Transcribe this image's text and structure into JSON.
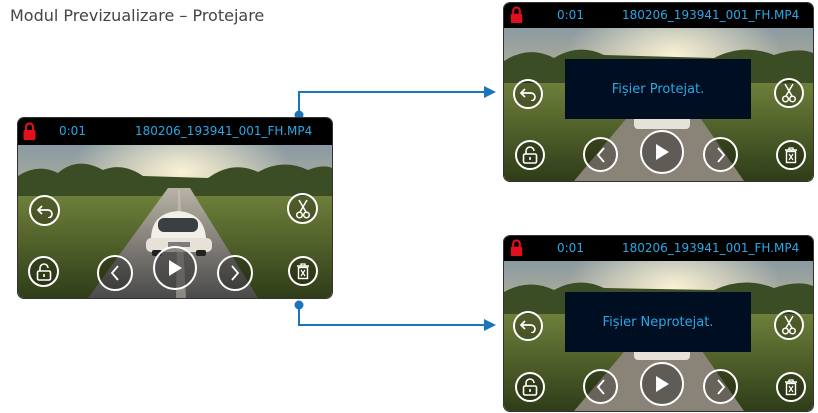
{
  "page": {
    "title": "Modul Previzualizare – Protejare"
  },
  "screens": {
    "main": {
      "time": "0:01",
      "filename": "180206_193941_001_FH.MP4"
    },
    "protected": {
      "time": "0:01",
      "filename": "180206_193941_001_FH.MP4",
      "message": "Fișier Protejat."
    },
    "unprotected": {
      "time": "0:01",
      "filename": "180206_193941_001_FH.MP4",
      "message": "Fișier Neprotejat."
    }
  },
  "icons": {
    "lock": "lock-icon",
    "back": "back-arrow-icon",
    "cut": "scissors-icon",
    "protect": "padlock-icon",
    "prev": "chevron-left-icon",
    "play": "play-icon",
    "next": "chevron-right-icon",
    "delete": "trash-icon"
  },
  "colors": {
    "accent": "#2aa7e6",
    "lock": "#e0101c",
    "connector": "#1b75bb",
    "message_bg": "#000e22"
  }
}
